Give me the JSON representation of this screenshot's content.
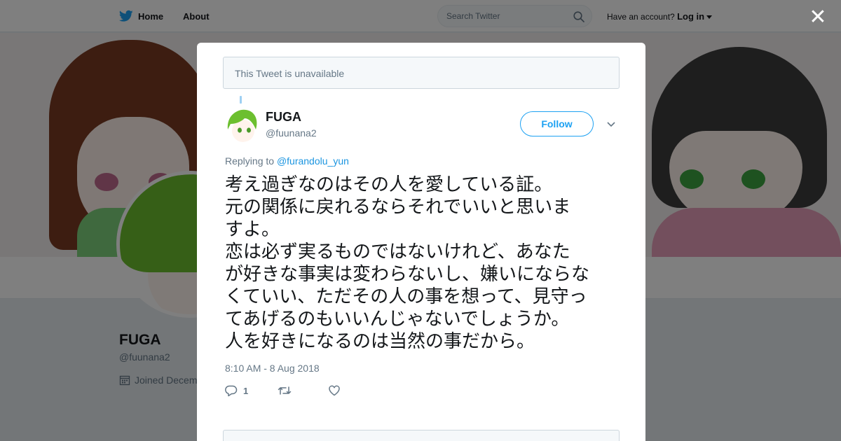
{
  "nav": {
    "home": "Home",
    "about": "About",
    "search_placeholder": "Search Twitter",
    "account_prompt": "Have an account?",
    "login": "Log in"
  },
  "profile": {
    "name": "FUGA",
    "handle": "@fuunana2",
    "joined": "Joined Decem"
  },
  "modal": {
    "unavailable_text": "This Tweet is unavailable",
    "tweet": {
      "name": "FUGA",
      "handle": "@fuunana2",
      "follow_label": "Follow",
      "replying_prefix": "Replying to ",
      "replying_to": "@furandolu_yun",
      "text": "考え過ぎなのはその人を愛している証。\n元の関係に戻れるならそれでいいと思いま\nすよ。\n恋は必ず実るものではないけれど、あなた\nが好きな事実は変わらないし、嫌いにならな\nくていい、ただその人の事を想って、見守っ\nてあげるのもいいんじゃないでしょうか。\n人を好きになるのは当然の事だから。",
      "timestamp": "8:10 AM - 8 Aug 2018",
      "reply_count": "1",
      "retweet_count": "",
      "like_count": ""
    }
  },
  "colors": {
    "twitter_blue": "#1da1f2",
    "link_blue": "#1b95e0",
    "muted": "#657786",
    "text": "#14171a"
  }
}
